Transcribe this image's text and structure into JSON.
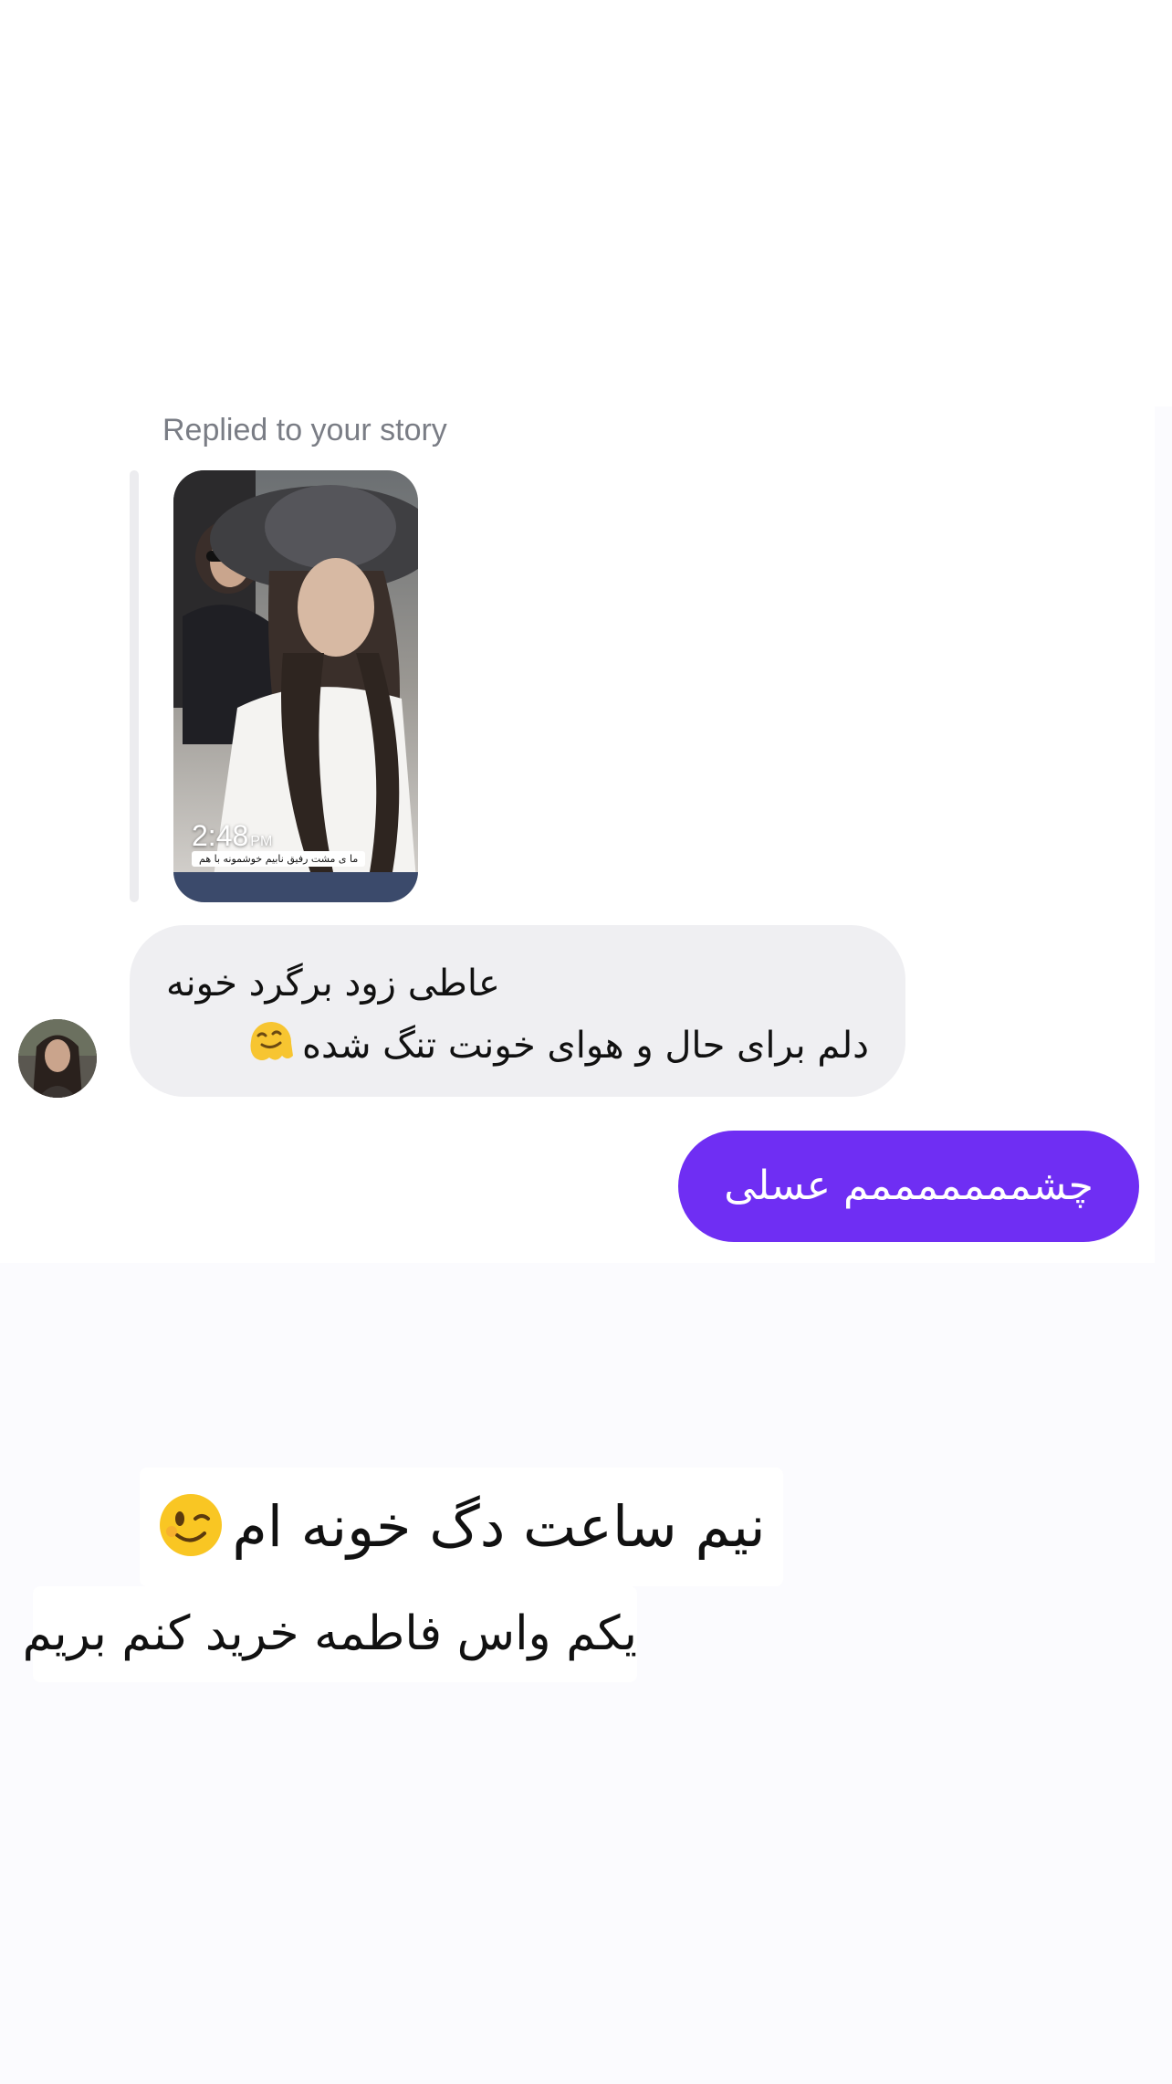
{
  "conversation": {
    "reply_context": {
      "label": "Replied to your story",
      "story_preview": {
        "time": "2:48",
        "time_suffix": "PM",
        "caption": "ما ی مشت رفیق نابیم خوشمونه با هم"
      }
    },
    "incoming_message": {
      "line_1": "عاطی زود برگرد خونه",
      "line_2": "دلم برای حال و هوای خونت تنگ شده",
      "emoji": "melting-face-icon"
    },
    "outgoing_message": {
      "text": "چشمممممممم عسلی"
    }
  },
  "story_overlay": {
    "line_1": "نیم ساعت دگ خونه ام",
    "line_1_emoji": "winking-face-icon",
    "line_2": "یکم واس فاطمه خرید کنم بریم"
  },
  "colors": {
    "outgoing_bubble": "#6f2ef3",
    "incoming_bubble": "#efeff2",
    "reply_label": "#7a7d85"
  }
}
